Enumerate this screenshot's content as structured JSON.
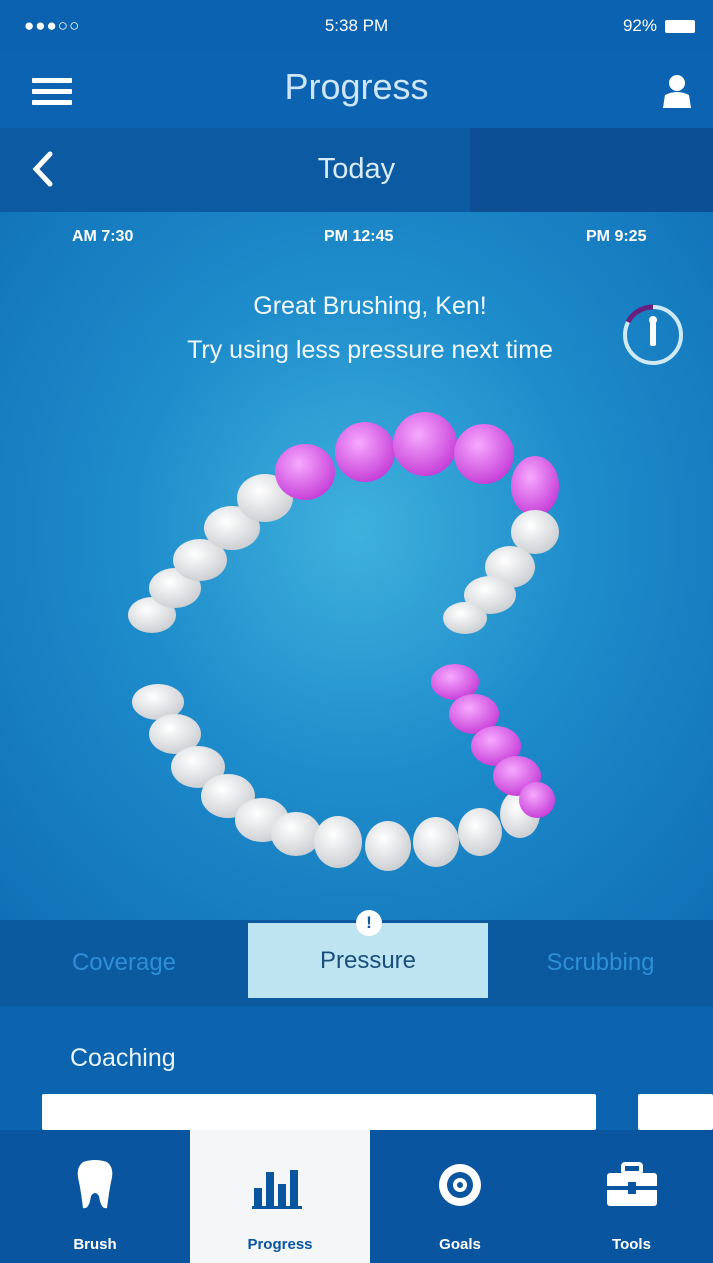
{
  "status_bar": {
    "signal": "●●●○○",
    "time": "5:38 PM",
    "battery": "92%"
  },
  "nav": {
    "title": "Progress"
  },
  "day_selector": {
    "label": "Today"
  },
  "sessions": [
    "AM 7:30",
    "PM 12:45",
    "PM 9:25"
  ],
  "message": {
    "line1": "Great Brushing, Ken!",
    "line2": "Try using less pressure next time"
  },
  "alert_badge": "!",
  "tabs": [
    "Coverage",
    "Pressure",
    "Scrubbing"
  ],
  "coaching": {
    "heading": "Coaching"
  },
  "bottom_tabs": [
    "Brush",
    "Progress",
    "Goals",
    "Tools"
  ],
  "colors": {
    "primary": "#0a55a0",
    "highlight": "#d94ee8",
    "tooth": "#e6e6e6",
    "tab_active": "#bfe4f1"
  }
}
